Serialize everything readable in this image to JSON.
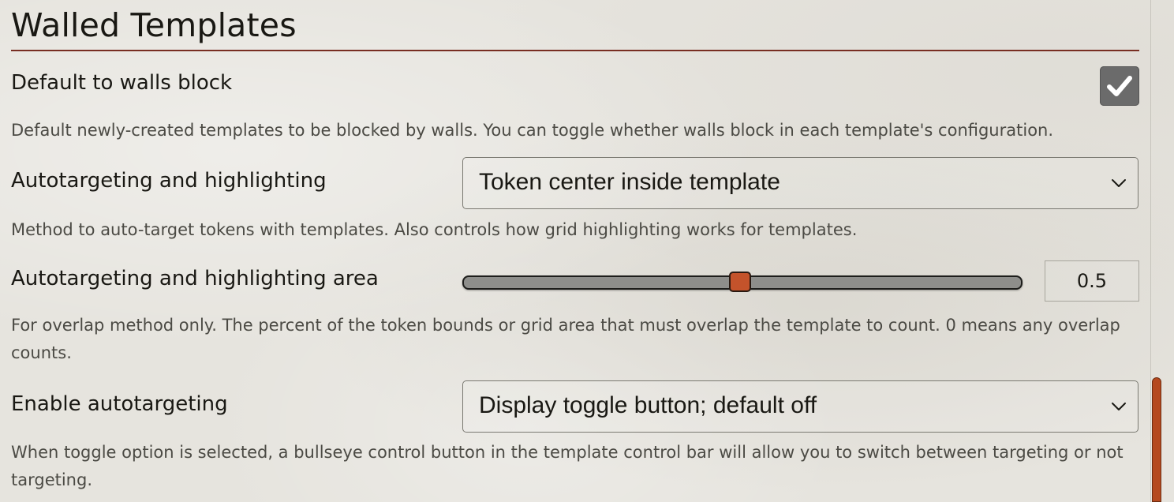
{
  "section": {
    "title": "Walled Templates"
  },
  "settings": {
    "walls_block": {
      "label": "Default to walls block",
      "hint": "Default newly-created templates to be blocked by walls. You can toggle whether walls block in each template's configuration.",
      "checked": true
    },
    "autotarget_method": {
      "label": "Autotargeting and highlighting",
      "selected": "Token center inside template",
      "hint": "Method to auto-target tokens with templates. Also controls how grid highlighting works for templates."
    },
    "autotarget_area": {
      "label": "Autotargeting and highlighting area",
      "value": "0.5",
      "min": 0,
      "max": 1,
      "hint": "For overlap method only. The percent of the token bounds or grid area that must overlap the template to count. 0 means any overlap counts."
    },
    "enable_autotarget": {
      "label": "Enable autotargeting",
      "selected": "Display toggle button; default off",
      "hint": "When toggle option is selected, a bullseye control button in the template control bar will allow you to switch between targeting or not targeting."
    }
  },
  "icons": {
    "checkmark": "checkmark-icon",
    "chevron": "chevron-down-icon"
  },
  "colors": {
    "accent": "#c4532b",
    "rule": "#782e22",
    "checkbox_bg": "#6b6b6b",
    "scrollbar": "#b5491f"
  }
}
